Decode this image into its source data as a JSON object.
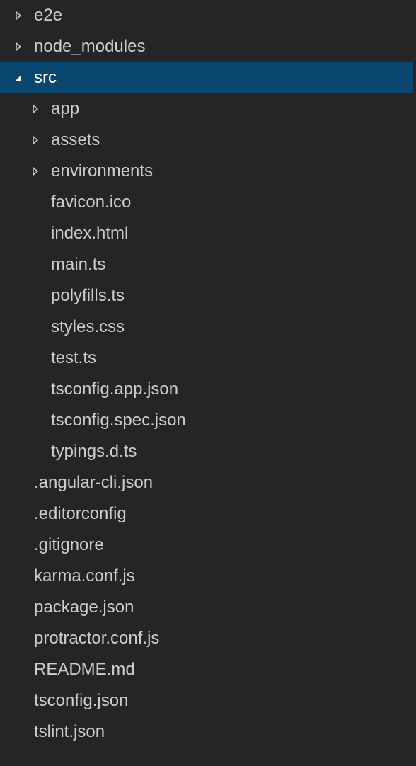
{
  "explorer": {
    "items": [
      {
        "label": "e2e",
        "kind": "folder",
        "expanded": false,
        "depth": 0,
        "icon": "chevron-right-icon"
      },
      {
        "label": "node_modules",
        "kind": "folder",
        "expanded": false,
        "depth": 0,
        "icon": "chevron-right-icon"
      },
      {
        "label": "src",
        "kind": "folder",
        "expanded": true,
        "depth": 0,
        "icon": "chevron-down-icon",
        "selected": true
      },
      {
        "label": "app",
        "kind": "folder",
        "expanded": false,
        "depth": 1,
        "icon": "chevron-right-icon"
      },
      {
        "label": "assets",
        "kind": "folder",
        "expanded": false,
        "depth": 1,
        "icon": "chevron-right-icon"
      },
      {
        "label": "environments",
        "kind": "folder",
        "expanded": false,
        "depth": 1,
        "icon": "chevron-right-icon"
      },
      {
        "label": "favicon.ico",
        "kind": "file",
        "depth": 1
      },
      {
        "label": "index.html",
        "kind": "file",
        "depth": 1
      },
      {
        "label": "main.ts",
        "kind": "file",
        "depth": 1
      },
      {
        "label": "polyfills.ts",
        "kind": "file",
        "depth": 1
      },
      {
        "label": "styles.css",
        "kind": "file",
        "depth": 1
      },
      {
        "label": "test.ts",
        "kind": "file",
        "depth": 1
      },
      {
        "label": "tsconfig.app.json",
        "kind": "file",
        "depth": 1
      },
      {
        "label": "tsconfig.spec.json",
        "kind": "file",
        "depth": 1
      },
      {
        "label": "typings.d.ts",
        "kind": "file",
        "depth": 1
      },
      {
        "label": ".angular-cli.json",
        "kind": "file",
        "depth": 0
      },
      {
        "label": ".editorconfig",
        "kind": "file",
        "depth": 0
      },
      {
        "label": ".gitignore",
        "kind": "file",
        "depth": 0
      },
      {
        "label": "karma.conf.js",
        "kind": "file",
        "depth": 0
      },
      {
        "label": "package.json",
        "kind": "file",
        "depth": 0
      },
      {
        "label": "protractor.conf.js",
        "kind": "file",
        "depth": 0
      },
      {
        "label": "README.md",
        "kind": "file",
        "depth": 0
      },
      {
        "label": "tsconfig.json",
        "kind": "file",
        "depth": 0
      },
      {
        "label": "tslint.json",
        "kind": "file",
        "depth": 0
      }
    ]
  },
  "colors": {
    "background": "#252526",
    "text": "#cccccc",
    "selected_background": "#094771",
    "selected_text": "#ffffff",
    "twistie": "#c5c5c5"
  }
}
